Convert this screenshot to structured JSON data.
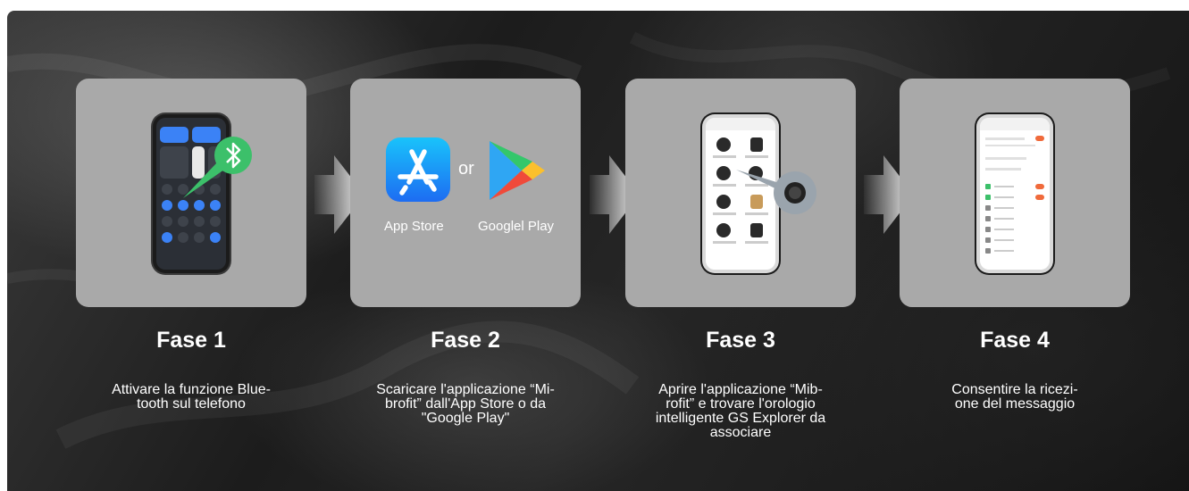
{
  "colors": {
    "card": "#a9a9a9",
    "text": "#ffffff",
    "bluetooth": "#3cc06a",
    "app_store": "#1f8cff"
  },
  "steps": [
    {
      "title": "Fase 1",
      "desc_lines": [
        "Attivare la funzione Blue-",
        "tooth sul telefono"
      ],
      "icon": "bluetooth-icon"
    },
    {
      "title": "Fase 2",
      "desc_lines": [
        "Scaricare l'applicazione “Mi-",
        "brofit” dall'App Store o da",
        "\"Google Play\""
      ],
      "app_store_label": "App Store",
      "or_label": "or",
      "google_play_label": "Googlel Play"
    },
    {
      "title": "Fase 3",
      "desc_lines": [
        "Aprire l'applicazione “Mib-",
        "rofit” e trovare l'orologio",
        "intelligente GS Explorer da",
        "associare"
      ]
    },
    {
      "title": "Fase 4",
      "desc_lines": [
        "Consentire la ricezi-",
        "one del messaggio"
      ]
    }
  ]
}
